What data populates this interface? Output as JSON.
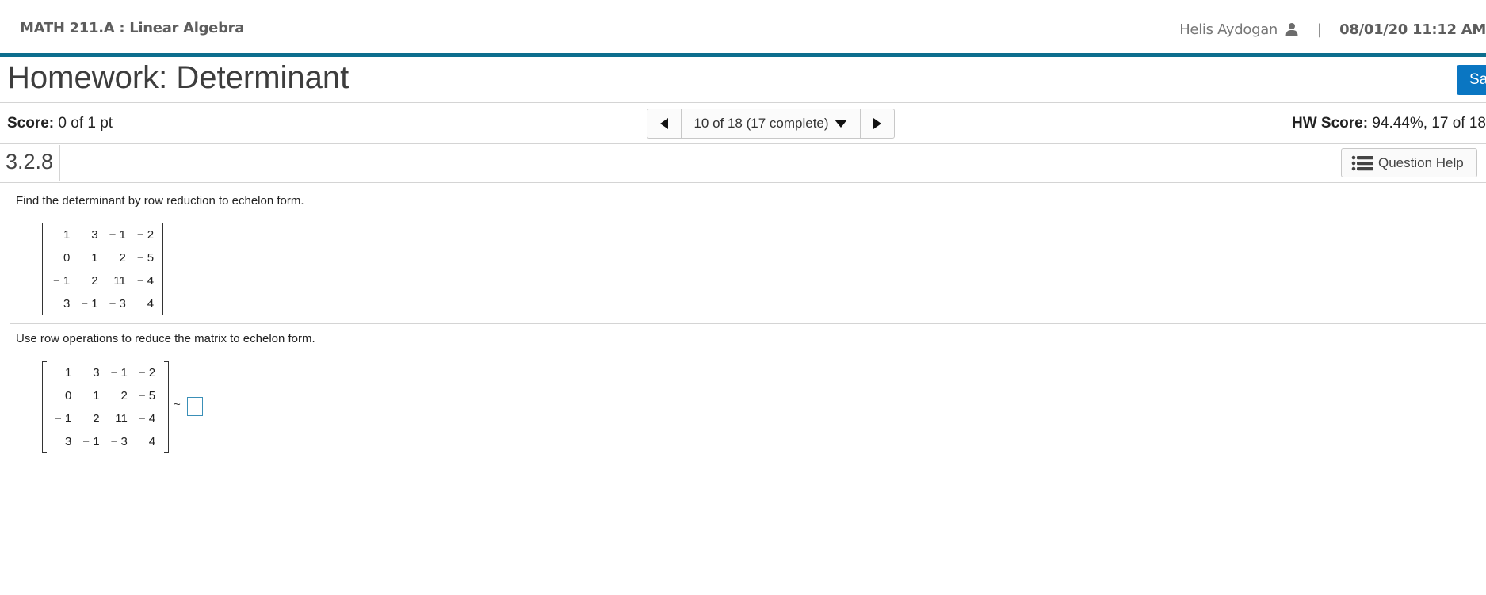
{
  "header": {
    "course_title": "MATH 211.A : Linear Algebra",
    "user_name": "Helis Aydogan",
    "separator": "|",
    "datetime": "08/01/20 11:12 AM",
    "accent_color": "#0d6e8e"
  },
  "homework": {
    "title": "Homework: Determinant",
    "save_label": "Sa"
  },
  "score_bar": {
    "score_label": "Score:",
    "score_value": "0 of 1 pt",
    "pager_text": "10 of 18 (17 complete)",
    "hw_score_label": "HW Score:",
    "hw_score_value": "94.44%, 17 of 18"
  },
  "question": {
    "number": "3.2.8",
    "help_label": "Question Help",
    "instruction_1": "Find the determinant by row reduction to echelon form.",
    "instruction_2": "Use row operations to reduce the matrix to echelon form.",
    "tilde": "~",
    "matrix": [
      [
        "1",
        "3",
        "− 1",
        "− 2"
      ],
      [
        "0",
        "1",
        "2",
        "− 5"
      ],
      [
        "− 1",
        "2",
        "11",
        "− 4"
      ],
      [
        "3",
        "− 1",
        "− 3",
        "4"
      ]
    ]
  },
  "icons": {
    "user": "user-icon",
    "prev": "triangle-left-icon",
    "next": "triangle-right-icon",
    "dropdown": "triangle-down-icon",
    "help": "list-icon"
  }
}
